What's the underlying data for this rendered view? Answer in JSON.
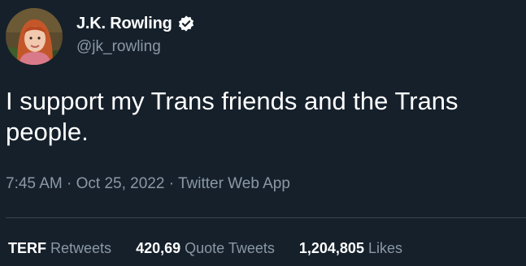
{
  "author": {
    "display_name": "J.K. Rowling",
    "handle": "@jk_rowling",
    "verified_icon": "verified-badge-icon"
  },
  "tweet": {
    "text": "I support my Trans friends and the Trans people."
  },
  "meta": {
    "time": "7:45 AM",
    "separator1": "·",
    "date": "Oct 25, 2022",
    "separator2": "·",
    "source": "Twitter Web App"
  },
  "stats": [
    {
      "count": "TERF",
      "label": "Retweets"
    },
    {
      "count": "420,69",
      "label": "Quote Tweets"
    },
    {
      "count": "1,204,805",
      "label": "Likes"
    }
  ],
  "colors": {
    "background": "#15202b",
    "secondary_text": "#8b98a5",
    "divider": "#38444d",
    "verified": "#ffffff"
  }
}
